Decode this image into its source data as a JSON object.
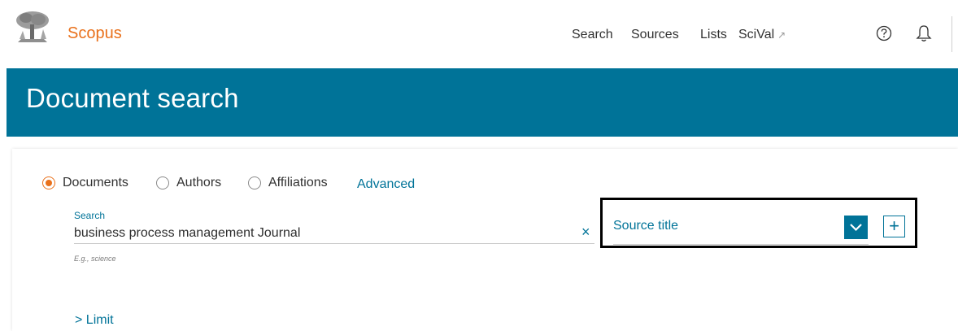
{
  "header": {
    "brand": "Scopus",
    "nav": {
      "search": "Search",
      "sources": "Sources",
      "lists": "Lists",
      "scival": "SciVal",
      "scival_ext": "↗"
    },
    "icons": {
      "logo": "elsevier-tree-logo",
      "help": "help-circle-icon",
      "bell": "bell-icon"
    }
  },
  "banner": {
    "title": "Document search"
  },
  "search": {
    "types": {
      "documents": "Documents",
      "authors": "Authors",
      "affiliations": "Affiliations"
    },
    "selected_type": "Documents",
    "advanced": "Advanced",
    "label": "Search",
    "value": "business process management Journal",
    "hint": "E.g., science",
    "clear": "×",
    "field_select": "Source title",
    "add": "+"
  },
  "limit": "> Limit",
  "colors": {
    "brand": "#e9711c",
    "accent": "#007398",
    "highlight": "#000000"
  }
}
